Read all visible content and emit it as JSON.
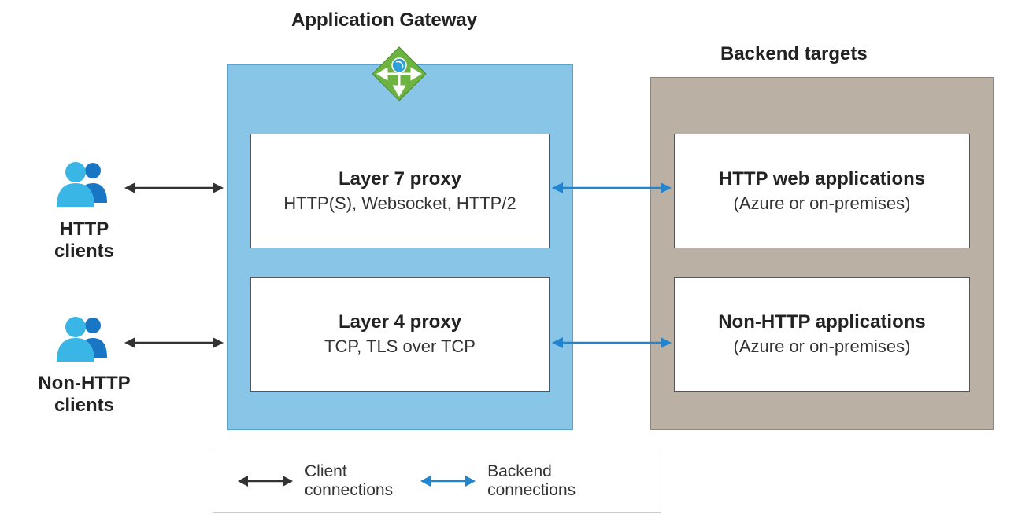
{
  "titles": {
    "gateway": "Application Gateway",
    "backend": "Backend targets"
  },
  "clients": {
    "http": "HTTP\nclients",
    "nonhttp": "Non-HTTP\nclients"
  },
  "proxies": {
    "layer7": {
      "title": "Layer 7 proxy",
      "sub": "HTTP(S), Websocket, HTTP/2"
    },
    "layer4": {
      "title": "Layer 4 proxy",
      "sub": "TCP, TLS over TCP"
    }
  },
  "backends": {
    "http": {
      "title": "HTTP web applications",
      "sub": "(Azure or on-premises)"
    },
    "nonhttp": {
      "title": "Non-HTTP applications",
      "sub": "(Azure or on-premises)"
    }
  },
  "legend": {
    "client": "Client\nconnections",
    "backend": "Backend\nconnections"
  },
  "colors": {
    "clientArrow": "#323232",
    "backendArrow": "#2185d0",
    "gatewayFill": "#89c5e6",
    "backendFill": "#bab0a3"
  }
}
